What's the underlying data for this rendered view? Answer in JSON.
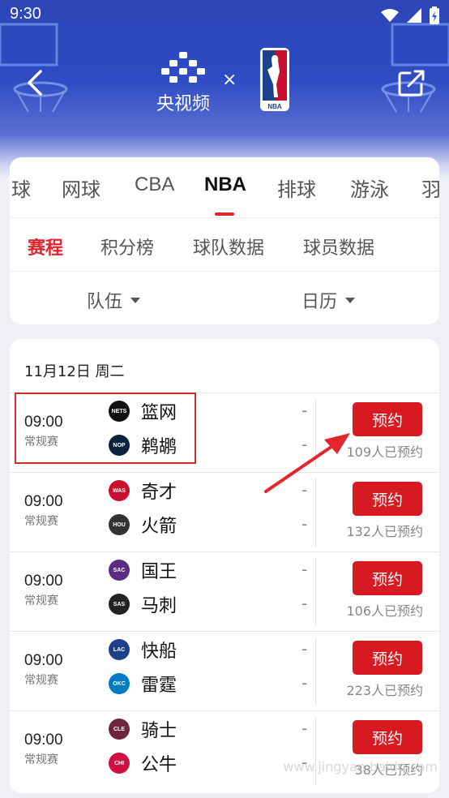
{
  "status_bar": {
    "time": "9:30"
  },
  "header": {
    "brand_name": "央视频",
    "times_symbol": "×",
    "nba_text": "NBA"
  },
  "sport_tabs": [
    "球",
    "网球",
    "CBA",
    "NBA",
    "排球",
    "游泳",
    "羽"
  ],
  "active_sport": "NBA",
  "sub_tabs": [
    "赛程",
    "积分榜",
    "球队数据",
    "球员数据"
  ],
  "active_sub_tab": "赛程",
  "filters": {
    "team": "队伍",
    "calendar": "日历"
  },
  "schedule": {
    "date": "11月12日 周二",
    "matches": [
      {
        "time": "09:00",
        "type": "常规赛",
        "team1": "篮网",
        "team1_abbr": "NETS",
        "team1_color": "#111111",
        "team2": "鹈鹕",
        "team2_abbr": "NOP",
        "team2_color": "#0c2340",
        "score1": "-",
        "score2": "-",
        "button": "预约",
        "reserved": "109人已预约"
      },
      {
        "time": "09:00",
        "type": "常规赛",
        "team1": "奇才",
        "team1_abbr": "WAS",
        "team1_color": "#c8102e",
        "team2": "火箭",
        "team2_abbr": "HOU",
        "team2_color": "#333333",
        "score1": "-",
        "score2": "-",
        "button": "预约",
        "reserved": "132人已预约"
      },
      {
        "time": "09:00",
        "type": "常规赛",
        "team1": "国王",
        "team1_abbr": "SAC",
        "team1_color": "#5a2d81",
        "team2": "马刺",
        "team2_abbr": "SAS",
        "team2_color": "#222222",
        "score1": "-",
        "score2": "-",
        "button": "预约",
        "reserved": "106人已预约"
      },
      {
        "time": "09:00",
        "type": "常规赛",
        "team1": "快船",
        "team1_abbr": "LAC",
        "team1_color": "#1d428a",
        "team2": "雷霆",
        "team2_abbr": "OKC",
        "team2_color": "#007ac1",
        "score1": "-",
        "score2": "-",
        "button": "预约",
        "reserved": "223人已预约"
      },
      {
        "time": "09:00",
        "type": "常规赛",
        "team1": "骑士",
        "team1_abbr": "CLE",
        "team1_color": "#6f263d",
        "team2": "公牛",
        "team2_abbr": "CHI",
        "team2_color": "#ce1141",
        "score1": "-",
        "score2": "-",
        "button": "预约",
        "reserved": "38人已预约"
      }
    ]
  },
  "colors": {
    "accent": "#e0252f",
    "button": "#d71a21",
    "header_blue": "#2f4cc4"
  }
}
